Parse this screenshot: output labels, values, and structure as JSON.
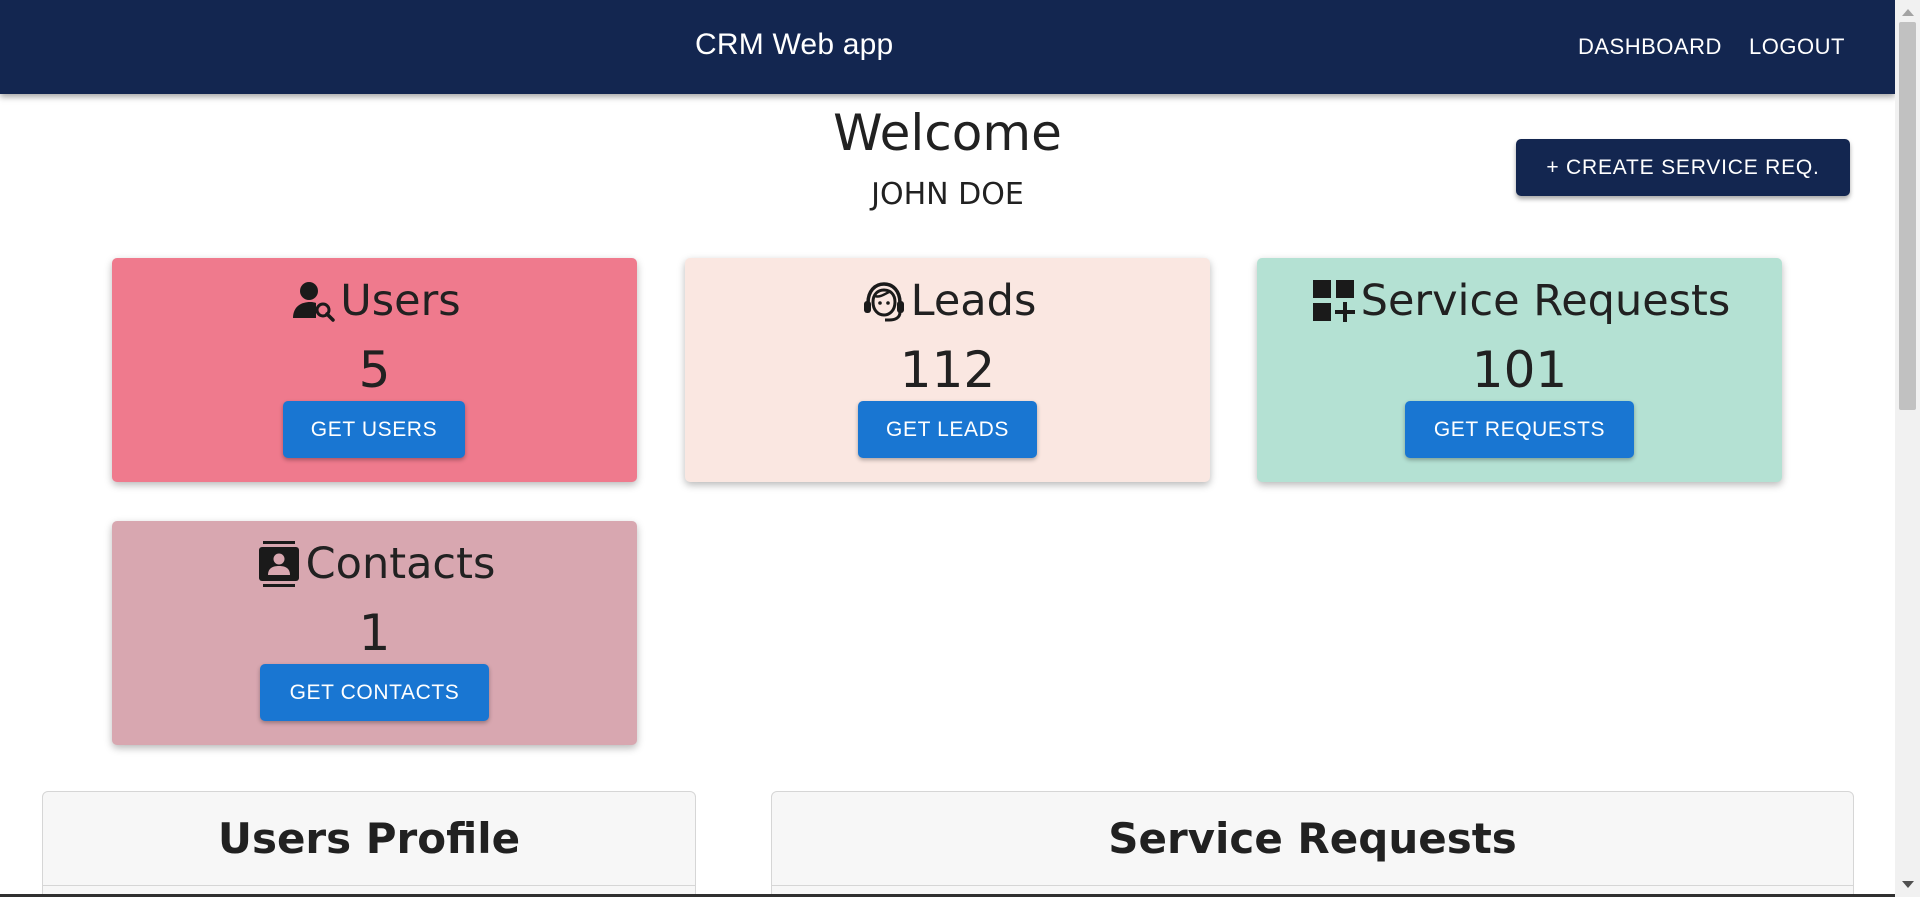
{
  "header": {
    "title": "CRM Web app",
    "nav": {
      "dashboard": "DASHBOARD",
      "logout": "LOGOUT"
    },
    "bg_color": "#132650"
  },
  "welcome": {
    "title": "Welcome",
    "user_name": "JOHN DOE"
  },
  "actions": {
    "create_service_request": "+ CREATE SERVICE REQ."
  },
  "cards": {
    "users": {
      "title": "Users",
      "count": "5",
      "button": "GET USERS",
      "icon": "user-search-icon",
      "color": "#ef7a8d"
    },
    "leads": {
      "title": "Leads",
      "count": "112",
      "button": "GET LEADS",
      "icon": "headset-icon",
      "color": "#fae7e1"
    },
    "service_requests": {
      "title": "Service Requests",
      "count": "101",
      "button": "GET REQUESTS",
      "icon": "dashboard-add-icon",
      "color": "#b4e1d3"
    },
    "contacts": {
      "title": "Contacts",
      "count": "1",
      "button": "GET CONTACTS",
      "icon": "contact-card-icon",
      "color": "#d8a7b0"
    }
  },
  "panels": {
    "users_profile": {
      "title": "Users Profile"
    },
    "service_requests": {
      "title": "Service Requests"
    }
  },
  "accent_color": "#1976d2"
}
